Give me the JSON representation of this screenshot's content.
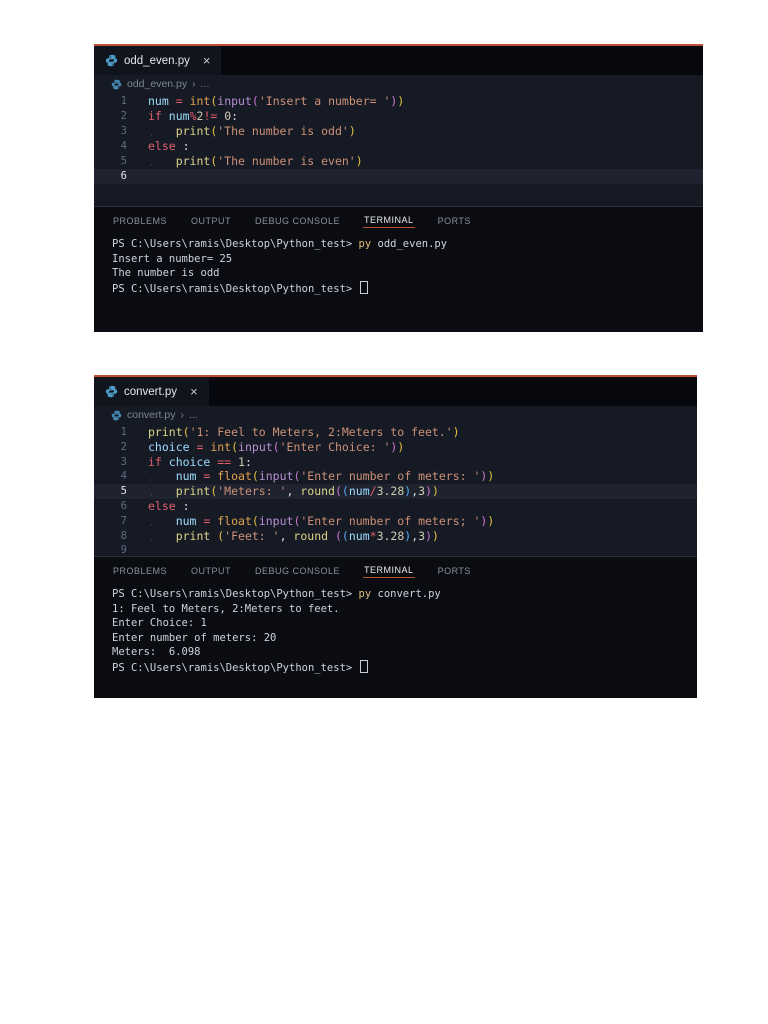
{
  "colors": {
    "accent-line": "#bf4f38",
    "editor-bg": "#161a24",
    "tabbar-bg": "#06080d",
    "tab-active-bg": "#10141d",
    "panel-bg": "#0a0c12",
    "panel-border": "#2b303c",
    "gutter": "#616a80",
    "gutter-active": "#dfe3ea",
    "line-highlight": "#1e232f",
    "breadcrumb": "#7c8495",
    "tab-text": "#e2e6ec",
    "panel-tab-inactive": "#8b919c",
    "panel-tab-active": "#e8eaed",
    "panel-tab-underline": "#b4532a",
    "py-icon": "#4e9bc8",
    "tokens": {
      "kw": "#e25f6d",
      "op": "#e25f6d",
      "typ": "#e0a050",
      "fn": "#dcd388",
      "inp": "#b88fd4",
      "str": "#cd9077",
      "num": "#cdcbb0",
      "var": "#9cdcfe",
      "txt": "#d6dae2",
      "b1": "#e2c23f",
      "b2": "#ce76d0",
      "b3": "#56a8f5",
      "cmd": "#e2c07b",
      "t": "#cfd3dc"
    }
  },
  "windows": [
    {
      "tab": {
        "filename": "odd_even.py",
        "close": "×"
      },
      "breadcrumb": {
        "file": "odd_even.py",
        "sep": "›",
        "rest": "..."
      },
      "code": {
        "lines": [
          {
            "n": 1,
            "indent": 0,
            "tokens": [
              {
                "t": "num ",
                "c": "var"
              },
              {
                "t": "= ",
                "c": "op"
              },
              {
                "t": "int",
                "c": "typ"
              },
              {
                "t": "(",
                "c": "b1"
              },
              {
                "t": "input",
                "c": "inp"
              },
              {
                "t": "(",
                "c": "b2"
              },
              {
                "t": "'Insert a number= '",
                "c": "str"
              },
              {
                "t": ")",
                "c": "b2"
              },
              {
                "t": ")",
                "c": "b1"
              }
            ]
          },
          {
            "n": 2,
            "indent": 0,
            "tokens": [
              {
                "t": "if ",
                "c": "kw"
              },
              {
                "t": "num",
                "c": "var"
              },
              {
                "t": "%",
                "c": "op"
              },
              {
                "t": "2",
                "c": "num"
              },
              {
                "t": "!= ",
                "c": "op"
              },
              {
                "t": "0",
                "c": "num"
              },
              {
                "t": ":",
                "c": "txt"
              }
            ]
          },
          {
            "n": 3,
            "indent": 1,
            "tokens": [
              {
                "t": "print",
                "c": "fn"
              },
              {
                "t": "(",
                "c": "b1"
              },
              {
                "t": "'The number is odd'",
                "c": "str"
              },
              {
                "t": ")",
                "c": "b1"
              }
            ]
          },
          {
            "n": 4,
            "indent": 0,
            "tokens": [
              {
                "t": "else ",
                "c": "kw"
              },
              {
                "t": ":",
                "c": "txt"
              }
            ]
          },
          {
            "n": 5,
            "indent": 1,
            "tokens": [
              {
                "t": "print",
                "c": "fn"
              },
              {
                "t": "(",
                "c": "b1"
              },
              {
                "t": "'The number is even'",
                "c": "str"
              },
              {
                "t": ")",
                "c": "b1"
              }
            ]
          },
          {
            "n": 6,
            "indent": 0,
            "current": true,
            "tokens": []
          }
        ]
      },
      "panel": {
        "tabs": [
          "PROBLEMS",
          "OUTPUT",
          "DEBUG CONSOLE",
          "TERMINAL",
          "PORTS"
        ],
        "active": "TERMINAL",
        "height": 125
      },
      "terminal": {
        "lines": [
          {
            "tokens": [
              {
                "t": "PS C:\\Users\\ramis\\Desktop\\Python_test> ",
                "c": "t"
              },
              {
                "t": "py",
                "c": "cmd"
              },
              {
                "t": " odd_even.py",
                "c": "t"
              }
            ]
          },
          {
            "tokens": [
              {
                "t": "Insert a number= 25",
                "c": "t"
              }
            ]
          },
          {
            "tokens": [
              {
                "t": "The number is odd",
                "c": "t"
              }
            ]
          },
          {
            "tokens": [
              {
                "t": "PS C:\\Users\\ramis\\Desktop\\Python_test> ",
                "c": "t"
              }
            ],
            "cursor": true
          }
        ]
      }
    },
    {
      "tab": {
        "filename": "convert.py",
        "close": "×"
      },
      "breadcrumb": {
        "file": "convert.py",
        "sep": "›",
        "rest": "..."
      },
      "code": {
        "lines": [
          {
            "n": 1,
            "indent": 0,
            "tokens": [
              {
                "t": "print",
                "c": "fn"
              },
              {
                "t": "(",
                "c": "b1"
              },
              {
                "t": "'1: Feel to Meters, 2:Meters to feet.'",
                "c": "str"
              },
              {
                "t": ")",
                "c": "b1"
              }
            ]
          },
          {
            "n": 2,
            "indent": 0,
            "tokens": [
              {
                "t": "choice ",
                "c": "var"
              },
              {
                "t": "= ",
                "c": "op"
              },
              {
                "t": "int",
                "c": "typ"
              },
              {
                "t": "(",
                "c": "b1"
              },
              {
                "t": "input",
                "c": "inp"
              },
              {
                "t": "(",
                "c": "b2"
              },
              {
                "t": "'Enter Choice: '",
                "c": "str"
              },
              {
                "t": ")",
                "c": "b2"
              },
              {
                "t": ")",
                "c": "b1"
              }
            ]
          },
          {
            "n": 3,
            "indent": 0,
            "tokens": [
              {
                "t": "if ",
                "c": "kw"
              },
              {
                "t": "choice ",
                "c": "var"
              },
              {
                "t": "== ",
                "c": "op"
              },
              {
                "t": "1",
                "c": "num"
              },
              {
                "t": ":",
                "c": "txt"
              }
            ]
          },
          {
            "n": 4,
            "indent": 1,
            "tokens": [
              {
                "t": "num ",
                "c": "var"
              },
              {
                "t": "= ",
                "c": "op"
              },
              {
                "t": "float",
                "c": "typ"
              },
              {
                "t": "(",
                "c": "b1"
              },
              {
                "t": "input",
                "c": "inp"
              },
              {
                "t": "(",
                "c": "b2"
              },
              {
                "t": "'Enter number of meters: '",
                "c": "str"
              },
              {
                "t": ")",
                "c": "b2"
              },
              {
                "t": ")",
                "c": "b1"
              }
            ]
          },
          {
            "n": 5,
            "indent": 1,
            "current": true,
            "tokens": [
              {
                "t": "print",
                "c": "fn"
              },
              {
                "t": "(",
                "c": "b1"
              },
              {
                "t": "'Meters: '",
                "c": "str"
              },
              {
                "t": ", ",
                "c": "txt"
              },
              {
                "t": "round",
                "c": "fn"
              },
              {
                "t": "(",
                "c": "b2"
              },
              {
                "t": "(",
                "c": "b3"
              },
              {
                "t": "num",
                "c": "var"
              },
              {
                "t": "/",
                "c": "op"
              },
              {
                "t": "3.28",
                "c": "num"
              },
              {
                "t": ")",
                "c": "b3"
              },
              {
                "t": ",",
                "c": "txt"
              },
              {
                "t": "3",
                "c": "num"
              },
              {
                "t": ")",
                "c": "b2"
              },
              {
                "t": ")",
                "c": "b1"
              }
            ]
          },
          {
            "n": 6,
            "indent": 0,
            "tokens": [
              {
                "t": "else ",
                "c": "kw"
              },
              {
                "t": ":",
                "c": "txt"
              }
            ]
          },
          {
            "n": 7,
            "indent": 1,
            "tokens": [
              {
                "t": "num ",
                "c": "var"
              },
              {
                "t": "= ",
                "c": "op"
              },
              {
                "t": "float",
                "c": "typ"
              },
              {
                "t": "(",
                "c": "b1"
              },
              {
                "t": "input",
                "c": "inp"
              },
              {
                "t": "(",
                "c": "b2"
              },
              {
                "t": "'Enter number of meters; '",
                "c": "str"
              },
              {
                "t": ")",
                "c": "b2"
              },
              {
                "t": ")",
                "c": "b1"
              }
            ]
          },
          {
            "n": 8,
            "indent": 1,
            "tokens": [
              {
                "t": "print ",
                "c": "fn"
              },
              {
                "t": "(",
                "c": "b1"
              },
              {
                "t": "'Feet: '",
                "c": "str"
              },
              {
                "t": ", ",
                "c": "txt"
              },
              {
                "t": "round ",
                "c": "fn"
              },
              {
                "t": "(",
                "c": "b2"
              },
              {
                "t": "(",
                "c": "b3"
              },
              {
                "t": "num",
                "c": "var"
              },
              {
                "t": "*",
                "c": "op"
              },
              {
                "t": "3.28",
                "c": "num"
              },
              {
                "t": ")",
                "c": "b3"
              },
              {
                "t": ",",
                "c": "txt"
              },
              {
                "t": "3",
                "c": "num"
              },
              {
                "t": ")",
                "c": "b2"
              },
              {
                "t": ")",
                "c": "b1"
              }
            ]
          },
          {
            "n": 9,
            "indent": 0,
            "tokens": []
          }
        ]
      },
      "panel": {
        "tabs": [
          "PROBLEMS",
          "OUTPUT",
          "DEBUG CONSOLE",
          "TERMINAL",
          "PORTS"
        ],
        "active": "TERMINAL",
        "height": 141
      },
      "terminal": {
        "lines": [
          {
            "tokens": [
              {
                "t": "PS C:\\Users\\ramis\\Desktop\\Python_test> ",
                "c": "t"
              },
              {
                "t": "py",
                "c": "cmd"
              },
              {
                "t": " convert.py",
                "c": "t"
              }
            ]
          },
          {
            "tokens": [
              {
                "t": "1: Feel to Meters, 2:Meters to feet.",
                "c": "t"
              }
            ]
          },
          {
            "tokens": [
              {
                "t": "Enter Choice: 1",
                "c": "t"
              }
            ]
          },
          {
            "tokens": [
              {
                "t": "Enter number of meters: 20",
                "c": "t"
              }
            ]
          },
          {
            "tokens": [
              {
                "t": "Meters:  6.098",
                "c": "t"
              }
            ]
          },
          {
            "tokens": [
              {
                "t": "PS C:\\Users\\ramis\\Desktop\\Python_test> ",
                "c": "t"
              }
            ],
            "cursor": true
          }
        ]
      }
    }
  ]
}
